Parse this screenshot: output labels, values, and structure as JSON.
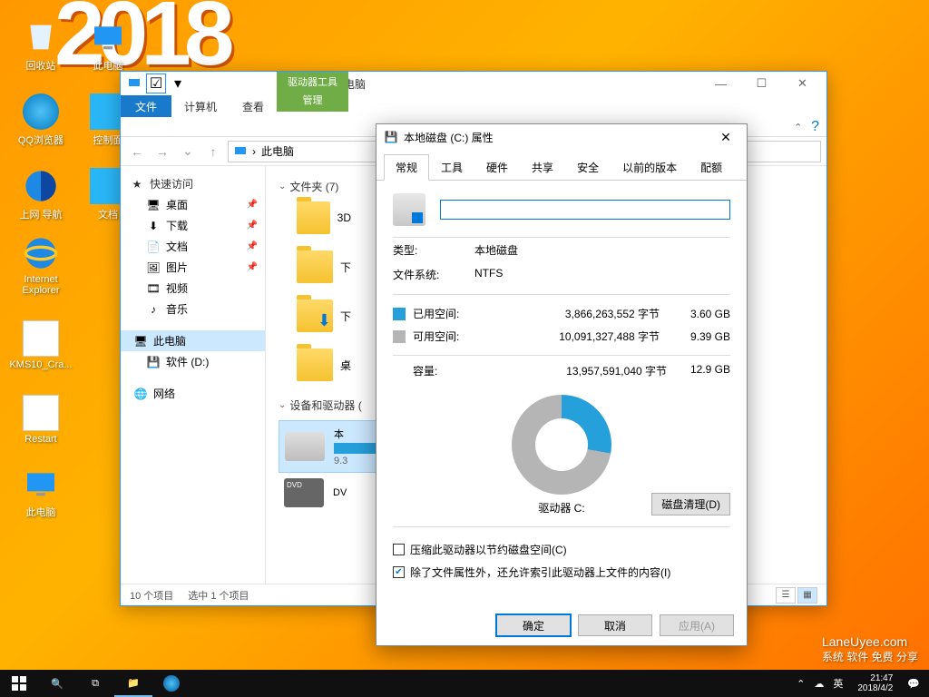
{
  "desktop": {
    "year_text": "2018",
    "icons": [
      {
        "label": "回收站"
      },
      {
        "label": "此电脑"
      },
      {
        "label": "QQ浏览器"
      },
      {
        "label": "控制面"
      },
      {
        "label": "上网 导航"
      },
      {
        "label": "文档"
      },
      {
        "label": "Internet Explorer"
      },
      {
        "label": ""
      },
      {
        "label": "KMS10_Cra..."
      },
      {
        "label": ""
      },
      {
        "label": "Restart"
      },
      {
        "label": ""
      },
      {
        "label": "此电脑"
      }
    ]
  },
  "explorer": {
    "title": "此电脑",
    "tools_context": "驱动器工具",
    "tabs": {
      "file": "文件",
      "computer": "计算机",
      "view": "查看",
      "manage": "管理"
    },
    "address": {
      "root": "此电脑"
    },
    "search_placeholder": "",
    "nav": {
      "quick": {
        "label": "快速访问",
        "items": [
          "桌面",
          "下载",
          "文档",
          "图片",
          "视频",
          "音乐"
        ]
      },
      "thispc": "此电脑",
      "software": "软件 (D:)",
      "network": "网络"
    },
    "folders": {
      "header": "文件夹 (7)",
      "items": [
        "3D",
        "下",
        "下",
        "桌"
      ]
    },
    "devices": {
      "header": "设备和驱动器 (",
      "c": {
        "name": "本",
        "sub": "9.3"
      },
      "dvd": "DV"
    },
    "status": {
      "count": "10 个项目",
      "selected": "选中 1 个项目"
    }
  },
  "props": {
    "title": "本地磁盘 (C:) 属性",
    "tabs": [
      "常规",
      "工具",
      "硬件",
      "共享",
      "安全",
      "以前的版本",
      "配额"
    ],
    "name_value": "",
    "type_label": "类型:",
    "type_value": "本地磁盘",
    "fs_label": "文件系统:",
    "fs_value": "NTFS",
    "used_label": "已用空间:",
    "used_bytes": "3,866,263,552 字节",
    "used_gb": "3.60 GB",
    "free_label": "可用空间:",
    "free_bytes": "10,091,327,488 字节",
    "free_gb": "9.39 GB",
    "cap_label": "容量:",
    "cap_bytes": "13,957,591,040 字节",
    "cap_gb": "12.9 GB",
    "drive_label": "驱动器 C:",
    "cleanup": "磁盘清理(D)",
    "chk1": "压缩此驱动器以节约磁盘空间(C)",
    "chk2": "除了文件属性外，还允许索引此驱动器上文件的内容(I)",
    "ok": "确定",
    "cancel": "取消",
    "apply": "应用(A)"
  },
  "taskbar": {
    "ime": "英",
    "time": "21:47",
    "date": "2018/4/2"
  },
  "watermark": {
    "site": "LaneUyee.com",
    "tag": "系统 软件 免费 分享"
  }
}
